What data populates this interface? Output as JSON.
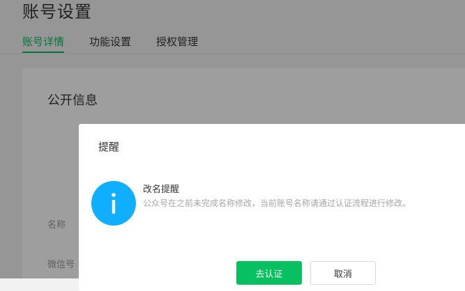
{
  "header": {
    "title": "账号设置"
  },
  "tabs": [
    {
      "label": "账号详情",
      "active": true
    },
    {
      "label": "功能设置",
      "active": false
    },
    {
      "label": "授权管理",
      "active": false
    }
  ],
  "card": {
    "section_title": "公开信息",
    "fields": [
      {
        "label": "名称"
      },
      {
        "label": "微信号"
      }
    ]
  },
  "dialog": {
    "title": "提醒",
    "icon": "info-icon",
    "message_title": "改名提醒",
    "message_body": "公众号在之前未完成名称修改，当前账号名称请通过认证流程进行修改。",
    "confirm_label": "去认证",
    "cancel_label": "取消"
  },
  "colors": {
    "accent": "#07c160",
    "info": "#10aeff"
  }
}
